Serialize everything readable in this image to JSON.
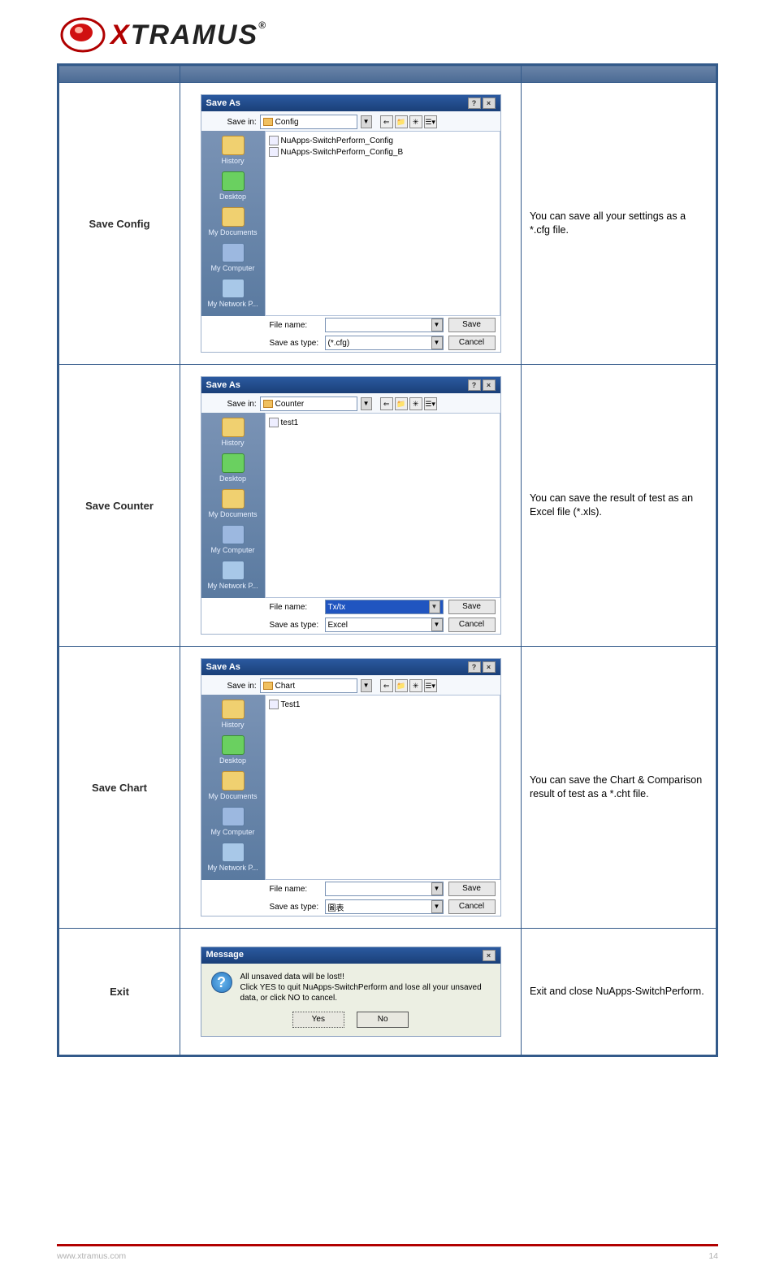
{
  "brand": {
    "x": "X",
    "rest": "TRAMUS",
    "reg": "®"
  },
  "table_header": {
    "c1": "",
    "c2": "",
    "c3": ""
  },
  "rows": [
    {
      "left": "Save Config",
      "right": "You can save all your settings as a *.cfg file.",
      "dlg": {
        "title": "Save As",
        "savein_label": "Save in:",
        "savein_value": "Config",
        "files": [
          "NuApps-SwitchPerform_Config",
          "NuApps-SwitchPerform_Config_B"
        ],
        "filename_label": "File name:",
        "filename_value": "",
        "type_label": "Save as type:",
        "type_value": "(*.cfg)",
        "save_btn": "Save",
        "cancel_btn": "Cancel"
      }
    },
    {
      "left": "Save Counter",
      "right": "You can save the result of test as an Excel file (*.xls).",
      "dlg": {
        "title": "Save As",
        "savein_label": "Save in:",
        "savein_value": "Counter",
        "files": [
          "test1"
        ],
        "filename_label": "File name:",
        "filename_value": "Tx/tx",
        "type_label": "Save as type:",
        "type_value": "Excel",
        "save_btn": "Save",
        "cancel_btn": "Cancel"
      }
    },
    {
      "left": "Save Chart",
      "right": "You can save the Chart & Comparison result of test as a *.cht file.",
      "dlg": {
        "title": "Save As",
        "savein_label": "Save in:",
        "savein_value": "Chart",
        "files": [
          "Test1"
        ],
        "filename_label": "File name:",
        "filename_value": "",
        "type_label": "Save as type:",
        "type_value": "圖表",
        "save_btn": "Save",
        "cancel_btn": "Cancel"
      }
    },
    {
      "left": "Exit",
      "right": "Exit and close NuApps-SwitchPerform.",
      "msg": {
        "title": "Message",
        "line1": "All unsaved data will be lost!!",
        "line2": "Click YES to quit NuApps-SwitchPerform and lose all your unsaved data, or click NO to cancel.",
        "yes": "Yes",
        "no": "No"
      }
    }
  ],
  "places": {
    "history": "History",
    "desktop": "Desktop",
    "mydocs": "My Documents",
    "mycomp": "My Computer",
    "mynet": "My Network P..."
  },
  "footer": {
    "left": "www.xtramus.com",
    "right": "14"
  }
}
